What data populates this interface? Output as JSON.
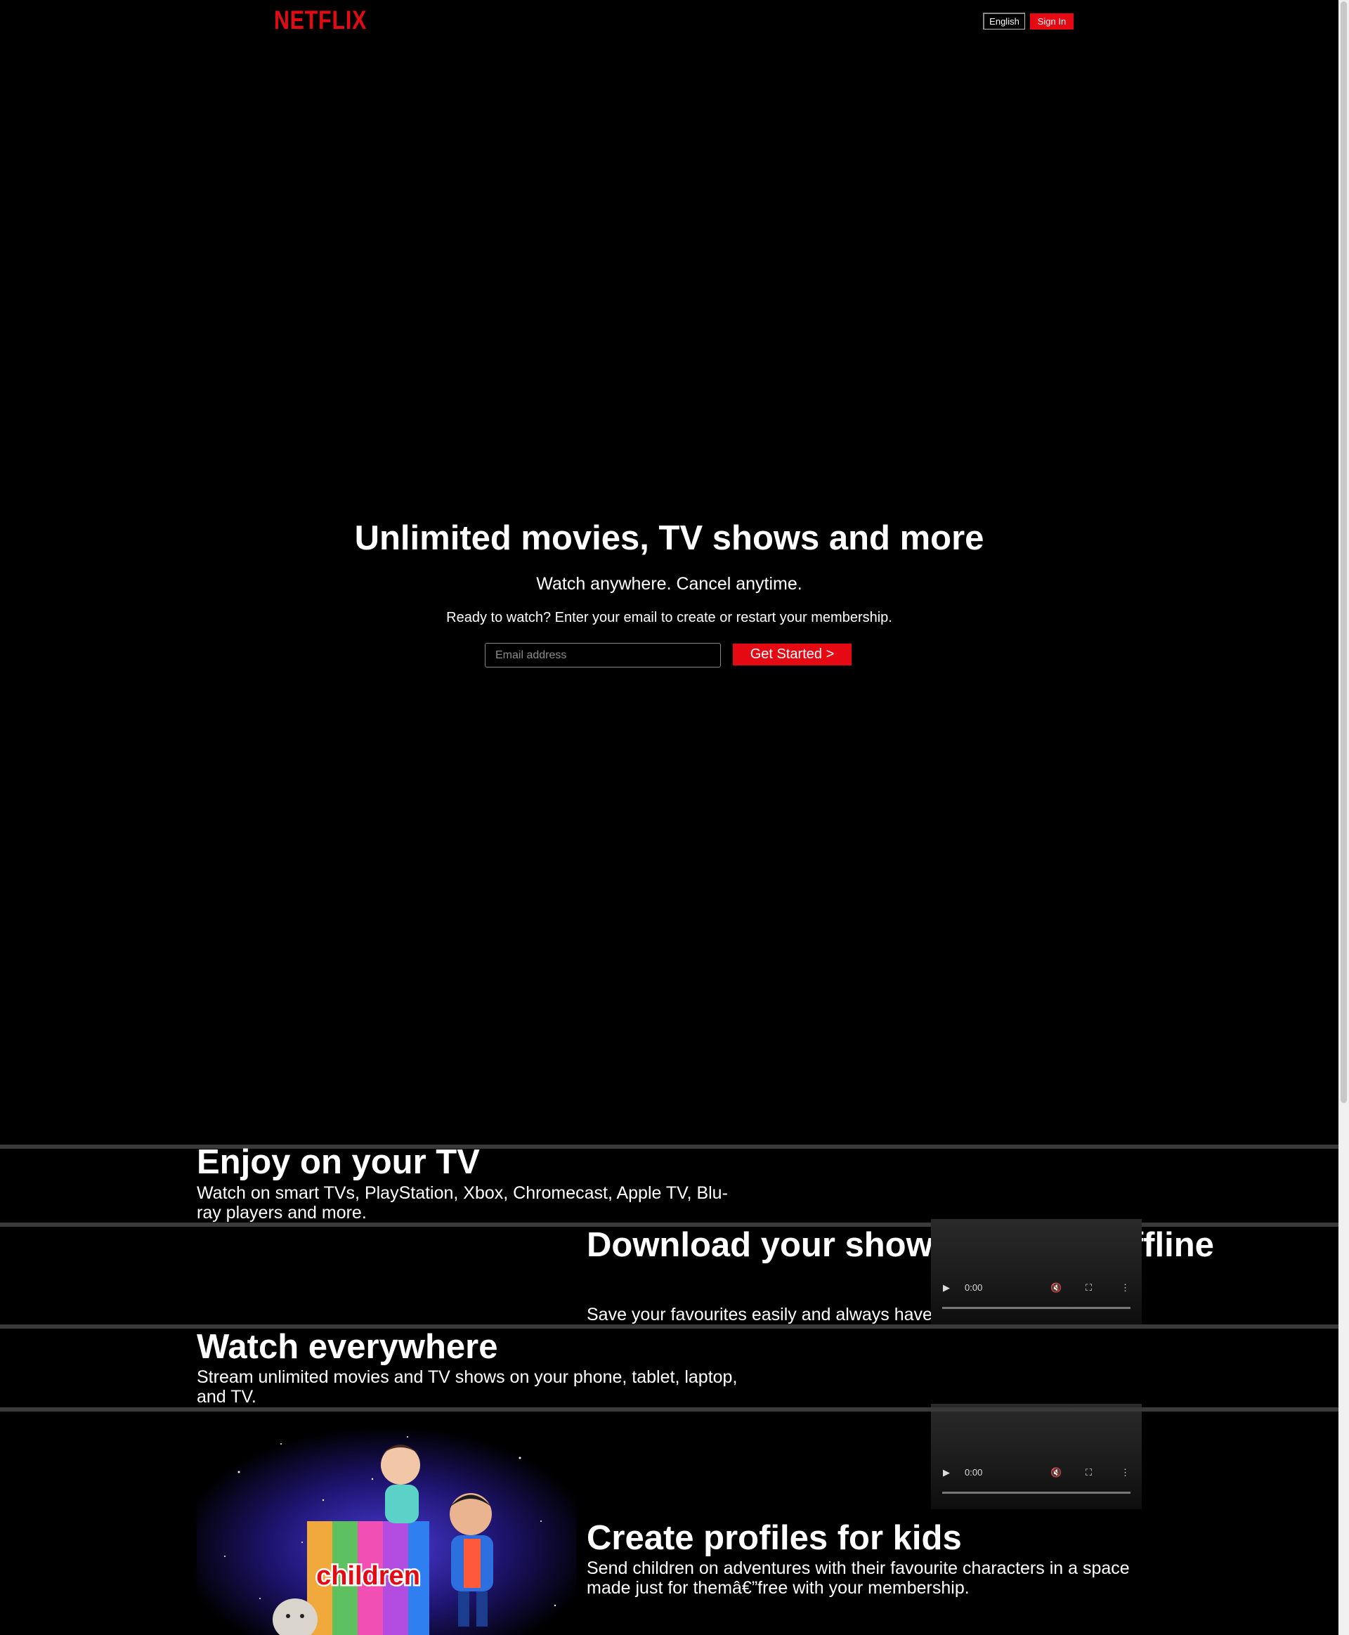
{
  "header": {
    "logo": "NETFLIX",
    "language": "English",
    "sign_in": "Sign In"
  },
  "hero": {
    "title": "Unlimited movies, TV shows and more",
    "subtitle": "Watch anywhere. Cancel anytime.",
    "ready_text": "Ready to watch? Enter your email to create or restart your membership.",
    "email_placeholder": "Email address",
    "cta": "Get Started >"
  },
  "sections": [
    {
      "title": "Enjoy on your TV",
      "text": "Watch on smart TVs, PlayStation, Xbox, Chromecast, Apple TV, Blu-ray players and more."
    },
    {
      "title": "Download your shows to watch offline",
      "text": "Save your favourites easily and always have something to watch."
    },
    {
      "title": "Watch everywhere",
      "text": "Stream unlimited movies and TV shows on your phone, tablet, laptop, and TV."
    },
    {
      "title": "Create profiles for kids",
      "text": "Send children on adventures with their favourite characters in a space made just for themâ€”free with your membership.",
      "image_label": "children"
    }
  ],
  "videos": [
    {
      "time": "0:00"
    },
    {
      "time": "0:00"
    }
  ],
  "icons": {
    "play": "play-icon",
    "mute": "muted-speaker-icon",
    "fullscreen": "fullscreen-icon",
    "more": "more-vertical-icon"
  },
  "colors": {
    "brand_red": "#e50914",
    "background": "#000000",
    "divider": "#3a3a3a"
  }
}
